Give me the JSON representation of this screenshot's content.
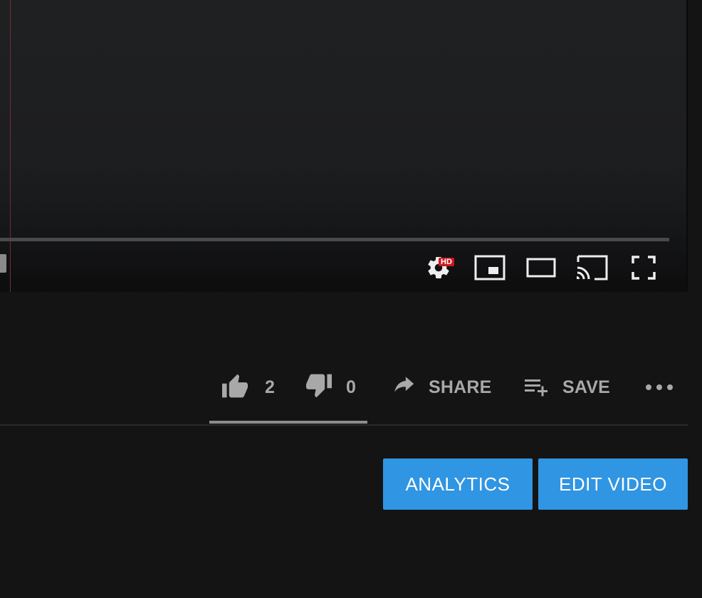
{
  "player": {
    "progress_fraction": 0.0,
    "controls": {
      "settings_icon": "gear-icon",
      "quality_badge": "HD",
      "miniplayer_icon": "miniplayer-icon",
      "theater_icon": "theater-mode-icon",
      "cast_icon": "cast-icon",
      "fullscreen_icon": "fullscreen-icon"
    }
  },
  "actions": {
    "like": {
      "icon": "thumbs-up-icon",
      "count": "2"
    },
    "dislike": {
      "icon": "thumbs-down-icon",
      "count": "0"
    },
    "share": {
      "icon": "share-arrow-icon",
      "label": "SHARE"
    },
    "save": {
      "icon": "playlist-add-icon",
      "label": "SAVE"
    },
    "more": {
      "icon": "more-horizontal-icon"
    },
    "sentiment_like_fraction": 1.0
  },
  "owner_buttons": {
    "analytics_label": "ANALYTICS",
    "edit_video_label": "EDIT VIDEO"
  },
  "colors": {
    "accent_blue": "#3095e2",
    "hd_red": "#cc181e",
    "icon_gray": "#a8a8a8",
    "background": "#141414"
  }
}
